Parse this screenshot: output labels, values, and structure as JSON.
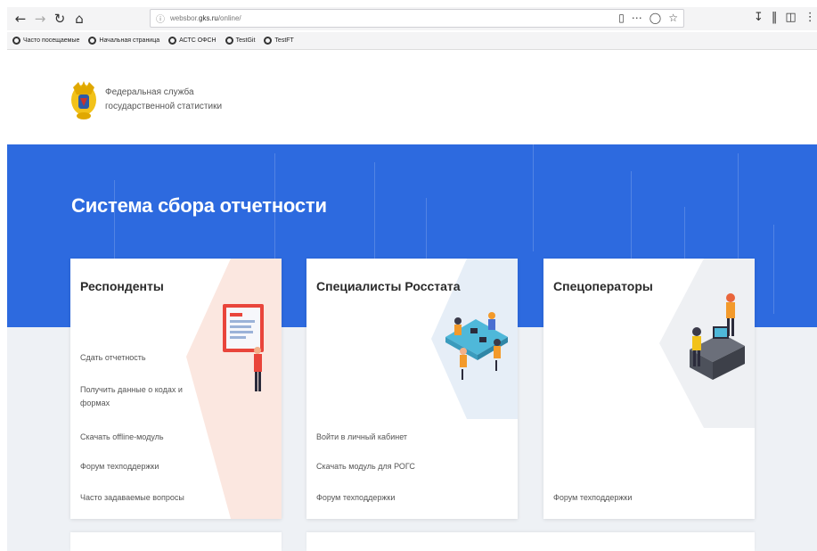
{
  "browser": {
    "url_prefix": "websbor.",
    "url_domain": "gks.ru",
    "url_path": "/online/",
    "bookmarks": [
      {
        "label": "Часто посещаемые"
      },
      {
        "label": "Начальная страница"
      },
      {
        "label": "АСТС ОФСН"
      },
      {
        "label": "TestGit"
      },
      {
        "label": "TestFT"
      }
    ]
  },
  "header": {
    "org_line1": "Федеральная служба",
    "org_line2": "государственной статистики"
  },
  "hero": {
    "title": "Система сбора отчетности"
  },
  "cards": [
    {
      "title": "Респонденты",
      "links": [
        "Сдать отчетность",
        "Получить данные о кодах и формах",
        "Скачать offline-модуль",
        "Форум техподдержки",
        "Часто задаваемые вопросы"
      ]
    },
    {
      "title": "Специалисты Росстата",
      "links": [
        "Войти в личный кабинет",
        "Скачать модуль для РОГС",
        "Форум техподдержки"
      ]
    },
    {
      "title": "Спецоператоры",
      "links": [
        "Форум техподдержки"
      ]
    }
  ],
  "colors": {
    "hero_blue": "#2d6adf",
    "page_bg": "#eef1f5"
  }
}
